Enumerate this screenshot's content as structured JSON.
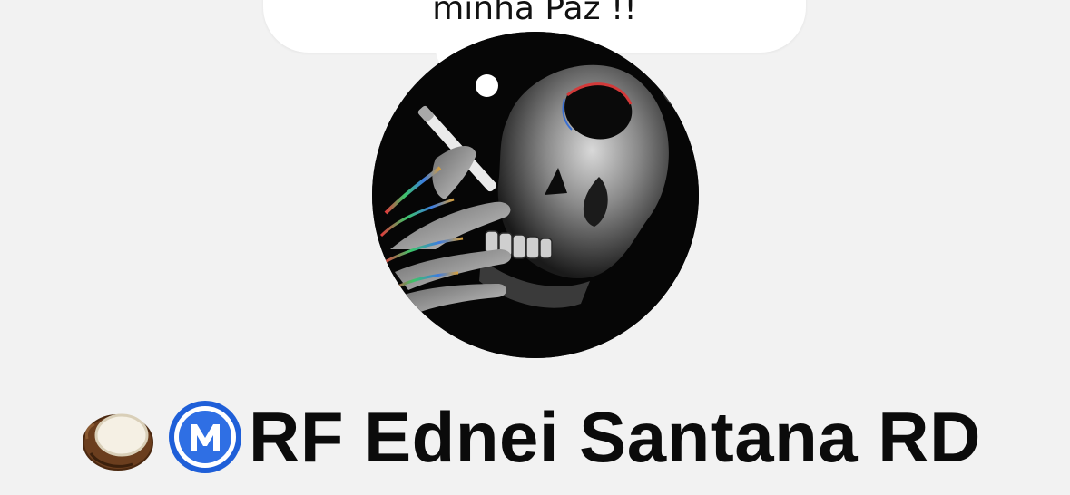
{
  "profile": {
    "note_text": "minha Paz !!",
    "display_name": "RF Ednei Santana RD",
    "name_prefix_icons": [
      "coconut-icon",
      "m-badge-icon"
    ],
    "avatar_alt": "profile photo"
  },
  "colors": {
    "background": "#f2f2f2",
    "bubble": "#ffffff",
    "text": "#0b0b0b",
    "badge_blue": "#2f6fe4"
  }
}
